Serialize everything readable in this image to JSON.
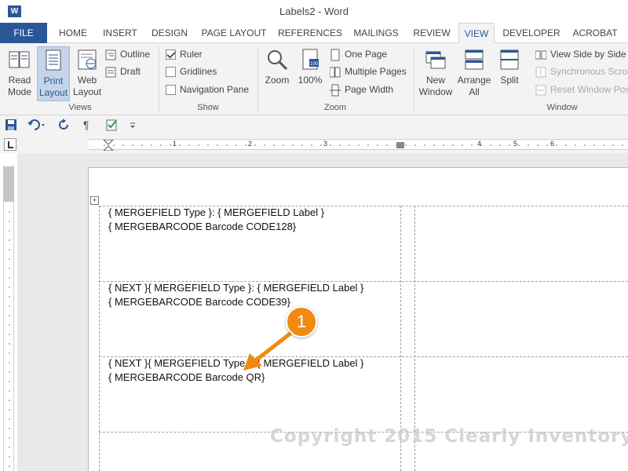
{
  "window": {
    "title": "Labels2 - Word",
    "app_icon": "W"
  },
  "tabs": [
    {
      "label": "FILE"
    },
    {
      "label": "HOME"
    },
    {
      "label": "INSERT"
    },
    {
      "label": "DESIGN"
    },
    {
      "label": "PAGE LAYOUT"
    },
    {
      "label": "REFERENCES"
    },
    {
      "label": "MAILINGS"
    },
    {
      "label": "REVIEW"
    },
    {
      "label": "VIEW"
    },
    {
      "label": "DEVELOPER"
    },
    {
      "label": "ACROBAT"
    }
  ],
  "ribbon": {
    "views": {
      "label": "Views",
      "read_mode": "Read Mode",
      "print_layout": "Print Layout",
      "web_layout": "Web Layout",
      "outline": "Outline",
      "draft": "Draft"
    },
    "show": {
      "label": "Show",
      "ruler": "Ruler",
      "gridlines": "Gridlines",
      "navigation_pane": "Navigation Pane"
    },
    "zoom": {
      "label": "Zoom",
      "zoom": "Zoom",
      "hundred": "100%",
      "one_page": "One Page",
      "multiple_pages": "Multiple Pages",
      "page_width": "Page Width"
    },
    "window": {
      "label": "Window",
      "new_window": "New Window",
      "arrange_all": "Arrange All",
      "split": "Split",
      "view_side_by_side": "View Side by Side",
      "synchronous_scrolling": "Synchronous Scrolling",
      "reset_window_position": "Reset Window Position"
    }
  },
  "ruler_numbers": [
    "1",
    "2",
    "3",
    "4",
    "5",
    "6"
  ],
  "document": {
    "label1": {
      "line1": "{ MERGEFIELD Type }:  { MERGEFIELD Label }",
      "line2": "{ MERGEBARCODE Barcode CODE128}"
    },
    "label2": {
      "line1": "{ NEXT }{ MERGEFIELD Type }:  { MERGEFIELD Label }",
      "line2": "{ MERGEBARCODE Barcode CODE39}"
    },
    "label3": {
      "line1": "{ NEXT }{ MERGEFIELD Type }:  { MERGEFIELD Label }",
      "line2": "{ MERGEBARCODE Barcode QR}"
    }
  },
  "callout": {
    "number": "1",
    "color": "#f08a12"
  },
  "watermark": "Copyright 2015 Clearly Inventory",
  "colors": {
    "accent": "#2b579a",
    "ribbon_bg": "#f3f3f3"
  }
}
